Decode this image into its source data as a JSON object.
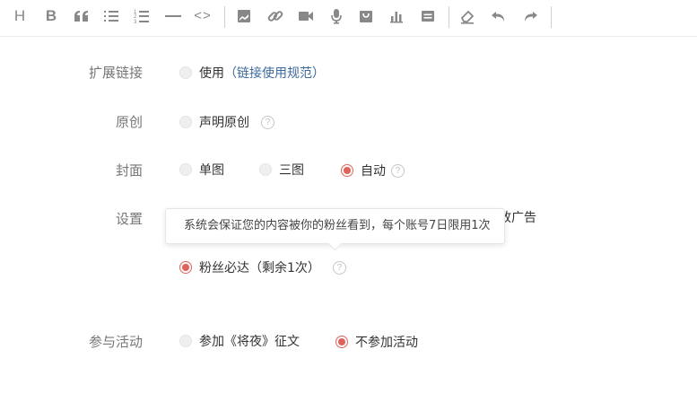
{
  "toolbar": {
    "heading_label": "H",
    "bold_label": "B",
    "code_label": "<>"
  },
  "form": {
    "extension_link": {
      "label": "扩展链接",
      "option_use": "使用",
      "paren_open": "（",
      "rules_link": "链接使用规范",
      "paren_close": "）"
    },
    "original": {
      "label": "原创",
      "option_declare": "声明原创",
      "help": "?"
    },
    "cover": {
      "label": "封面",
      "option_single": "单图",
      "option_triple": "三图",
      "option_auto": "自动",
      "selected": "自动",
      "help": "?"
    },
    "settings": {
      "label": "设置",
      "hidden_option_tail": "放广告",
      "tooltip": "系统会保证您的内容被你的粉丝看到，每个账号7日限用1次",
      "fans_reach": "粉丝必达（剩余1次）",
      "fans_reach_checked": true,
      "help": "?"
    },
    "activity": {
      "label": "参与活动",
      "option_join": "参加《将夜》征文",
      "option_not_join": "不参加活动",
      "selected": "不参加活动"
    }
  },
  "colors": {
    "accent": "#e0625a",
    "link": "#3d6a9e",
    "label": "#777777",
    "icon": "#888888"
  }
}
